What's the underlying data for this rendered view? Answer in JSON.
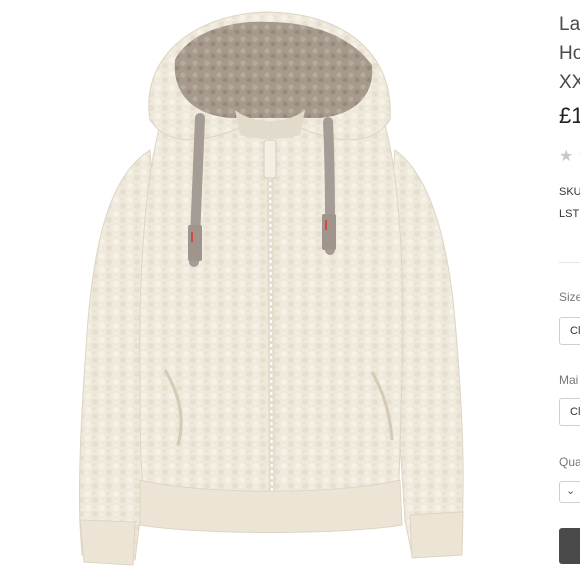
{
  "product": {
    "title_lines": [
      "La",
      "Ho",
      "XX"
    ],
    "price": "£1",
    "rating_stars": "★ ☆",
    "sku_label": "SKU",
    "sku_value": "LST",
    "image_alt": "Cream teddy fleece hoodie with taupe lined hood and zip front"
  },
  "options": {
    "size_label": "Size",
    "size_value": "Cl",
    "colour_label": "Mai",
    "colour_value": "Cl",
    "quantity_label": "Qua",
    "quantity_chevron": "⌄"
  },
  "colors": {
    "fleece": "#efe9dc",
    "fleece_shadow": "#ddd5c4",
    "hood_lining": "#a69a8c",
    "drawcord": "#a59c95",
    "button": "#4a4a4a"
  }
}
